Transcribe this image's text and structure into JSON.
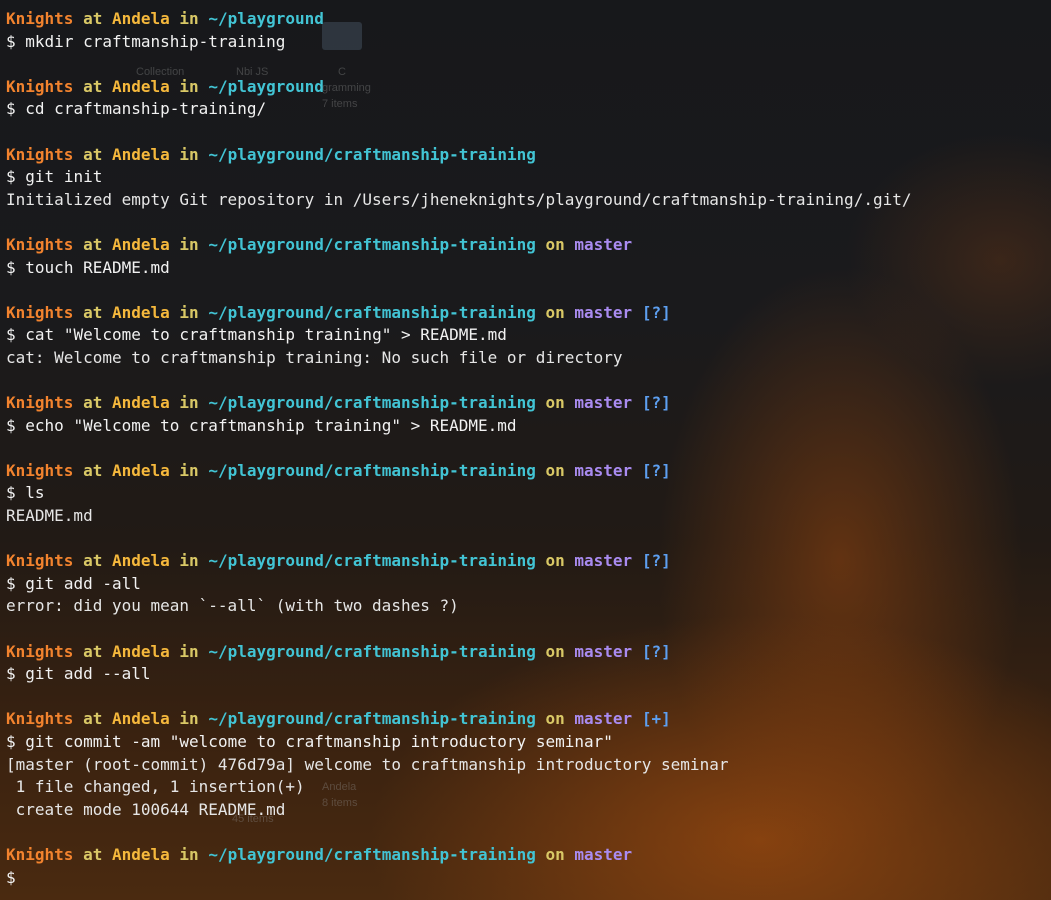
{
  "terminal": {
    "entries": [
      {
        "path": "~/playground",
        "branch": "",
        "status": "",
        "command": "mkdir craftmanship-training",
        "output": []
      },
      {
        "path": "~/playground",
        "branch": "",
        "status": "",
        "command": "cd craftmanship-training/",
        "output": []
      },
      {
        "path": "~/playground/craftmanship-training",
        "branch": "",
        "status": "",
        "command": "git init",
        "output": [
          "Initialized empty Git repository in /Users/jheneknights/playground/craftmanship-training/.git/"
        ]
      },
      {
        "path": "~/playground/craftmanship-training",
        "branch": "master",
        "status": "",
        "command": "touch README.md",
        "output": []
      },
      {
        "path": "~/playground/craftmanship-training",
        "branch": "master",
        "status": "[?]",
        "command": "cat \"Welcome to craftmanship training\" > README.md",
        "output": [
          "cat: Welcome to craftmanship training: No such file or directory"
        ]
      },
      {
        "path": "~/playground/craftmanship-training",
        "branch": "master",
        "status": "[?]",
        "command": "echo \"Welcome to craftmanship training\" > README.md",
        "output": []
      },
      {
        "path": "~/playground/craftmanship-training",
        "branch": "master",
        "status": "[?]",
        "command": "ls",
        "output": [
          "README.md"
        ]
      },
      {
        "path": "~/playground/craftmanship-training",
        "branch": "master",
        "status": "[?]",
        "command": "git add -all",
        "output": [
          "error: did you mean `--all` (with two dashes ?)"
        ]
      },
      {
        "path": "~/playground/craftmanship-training",
        "branch": "master",
        "status": "[?]",
        "command": "git add --all",
        "output": []
      },
      {
        "path": "~/playground/craftmanship-training",
        "branch": "master",
        "status": "[+]",
        "command": "git commit -am \"welcome to craftmanship introductory seminar\"",
        "output": [
          "[master (root-commit) 476d79a] welcome to craftmanship introductory seminar",
          " 1 file changed, 1 insertion(+)",
          " create mode 100644 README.md"
        ]
      },
      {
        "path": "~/playground/craftmanship-training",
        "branch": "master",
        "status": "",
        "command": "",
        "output": []
      }
    ]
  },
  "prompt": {
    "user": "Knights",
    "at": "at",
    "host": "Andela",
    "in": "in",
    "on": "on",
    "symbol": "$"
  },
  "wallpaper": {
    "ghost_labels": [
      "Collection",
      "Nbi JS",
      "C",
      "gramming",
      "7 items",
      "Andela",
      "8 items",
      "45 items"
    ]
  },
  "colors": {
    "user": "#f2832e",
    "host": "#f5b83c",
    "path": "#42c4d4",
    "branch": "#a98bf0",
    "status": "#5d9ff0"
  }
}
